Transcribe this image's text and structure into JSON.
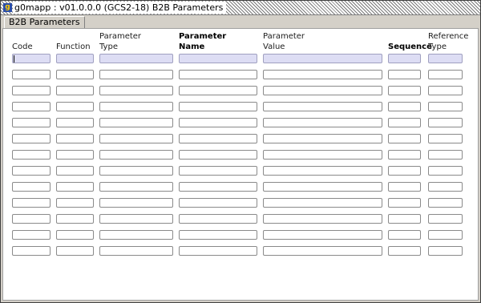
{
  "window": {
    "title": "g0mapp : v01.0.0.0 (GCS2-18) B2B Parameters",
    "icon": "app-icon"
  },
  "tabs": [
    {
      "label": "B2B Parameters",
      "active": true
    }
  ],
  "columns": [
    {
      "key": "code",
      "line1": "",
      "line2": "Code",
      "bold": false
    },
    {
      "key": "function",
      "line1": "",
      "line2": "Function",
      "bold": false
    },
    {
      "key": "parameter_type",
      "line1": "Parameter",
      "line2": "Type",
      "bold": false
    },
    {
      "key": "parameter_name",
      "line1": "Parameter",
      "line2": "Name",
      "bold": true
    },
    {
      "key": "parameter_value",
      "line1": "Parameter",
      "line2": "Value",
      "bold": false
    },
    {
      "key": "sequence",
      "line1": "",
      "line2": "Sequence",
      "bold": true
    },
    {
      "key": "reference_type",
      "line1": "Reference",
      "line2": "Type",
      "bold": false
    }
  ],
  "rows": [
    {
      "code": "",
      "function": "",
      "parameter_type": "",
      "parameter_name": "",
      "parameter_value": "",
      "sequence": "",
      "reference_type": ""
    },
    {
      "code": "",
      "function": "",
      "parameter_type": "",
      "parameter_name": "",
      "parameter_value": "",
      "sequence": "",
      "reference_type": ""
    },
    {
      "code": "",
      "function": "",
      "parameter_type": "",
      "parameter_name": "",
      "parameter_value": "",
      "sequence": "",
      "reference_type": ""
    },
    {
      "code": "",
      "function": "",
      "parameter_type": "",
      "parameter_name": "",
      "parameter_value": "",
      "sequence": "",
      "reference_type": ""
    },
    {
      "code": "",
      "function": "",
      "parameter_type": "",
      "parameter_name": "",
      "parameter_value": "",
      "sequence": "",
      "reference_type": ""
    },
    {
      "code": "",
      "function": "",
      "parameter_type": "",
      "parameter_name": "",
      "parameter_value": "",
      "sequence": "",
      "reference_type": ""
    },
    {
      "code": "",
      "function": "",
      "parameter_type": "",
      "parameter_name": "",
      "parameter_value": "",
      "sequence": "",
      "reference_type": ""
    },
    {
      "code": "",
      "function": "",
      "parameter_type": "",
      "parameter_name": "",
      "parameter_value": "",
      "sequence": "",
      "reference_type": ""
    },
    {
      "code": "",
      "function": "",
      "parameter_type": "",
      "parameter_name": "",
      "parameter_value": "",
      "sequence": "",
      "reference_type": ""
    },
    {
      "code": "",
      "function": "",
      "parameter_type": "",
      "parameter_name": "",
      "parameter_value": "",
      "sequence": "",
      "reference_type": ""
    },
    {
      "code": "",
      "function": "",
      "parameter_type": "",
      "parameter_name": "",
      "parameter_value": "",
      "sequence": "",
      "reference_type": ""
    },
    {
      "code": "",
      "function": "",
      "parameter_type": "",
      "parameter_name": "",
      "parameter_value": "",
      "sequence": "",
      "reference_type": ""
    },
    {
      "code": "",
      "function": "",
      "parameter_type": "",
      "parameter_name": "",
      "parameter_value": "",
      "sequence": "",
      "reference_type": ""
    }
  ],
  "current_row": 0,
  "colors": {
    "current_row_fill": "#ddddf4",
    "field_border": "#8a8a8a",
    "window_bg": "#d4d0c8"
  }
}
